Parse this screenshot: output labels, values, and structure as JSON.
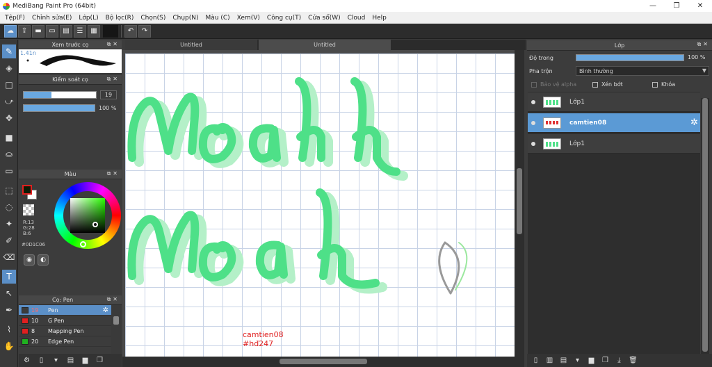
{
  "window": {
    "title": "MediBang Paint Pro (64bit)",
    "minimize": "—",
    "maximize": "❐",
    "close": "✕"
  },
  "menu": [
    "Tệp(F)",
    "Chỉnh sửa(E)",
    "Lớp(L)",
    "Bộ lọc(R)",
    "Chọn(S)",
    "Chụp(N)",
    "Màu (C)",
    "Xem(V)",
    "Công cụ(T)",
    "Cửa sổ(W)",
    "Cloud",
    "Help"
  ],
  "toolbar": {
    "undo": "↶",
    "redo": "↷"
  },
  "panels": {
    "brush_preview": {
      "title": "Xem trước cọ",
      "size": "1.41n"
    },
    "brush_control": {
      "title": "Kiểm soát cọ",
      "size_value": "19",
      "size_fill": 0.38,
      "opacity_value": "100 %",
      "opacity_fill": 1.0
    },
    "color": {
      "title": "Màu",
      "r": "R:13",
      "g": "G:28",
      "b": "B:6",
      "hex": "#0D1C06",
      "fg": "#0d1c06"
    },
    "brushes": {
      "title": "Cọ: Pen",
      "items": [
        {
          "num": "19",
          "name": "Pen",
          "color": "#3c3c3c",
          "selected": true
        },
        {
          "num": "10",
          "name": "G Pen",
          "color": "#e02020"
        },
        {
          "num": "8",
          "name": "Mapping Pen",
          "color": "#e02020"
        },
        {
          "num": "20",
          "name": "Edge Pen",
          "color": "#20b020"
        }
      ]
    },
    "layers": {
      "title": "Lớp",
      "opacity_label": "Độ trong",
      "opacity_value": "100 %",
      "opacity_fill": 1.0,
      "blend_label": "Pha trộn",
      "blend_value": "Bình thường",
      "protect_alpha": "Bảo vệ alpha",
      "clipping": "Xén bớt",
      "lock": "Khóa",
      "items": [
        {
          "name": "Lớp1",
          "selected": false
        },
        {
          "name": "camtien08",
          "selected": true
        },
        {
          "name": "Lớp1",
          "selected": false
        }
      ]
    }
  },
  "tabs": [
    "Untitled",
    "Untitled"
  ],
  "canvas": {
    "signature_line1": "camtien08",
    "signature_line2": "#hđ247"
  }
}
